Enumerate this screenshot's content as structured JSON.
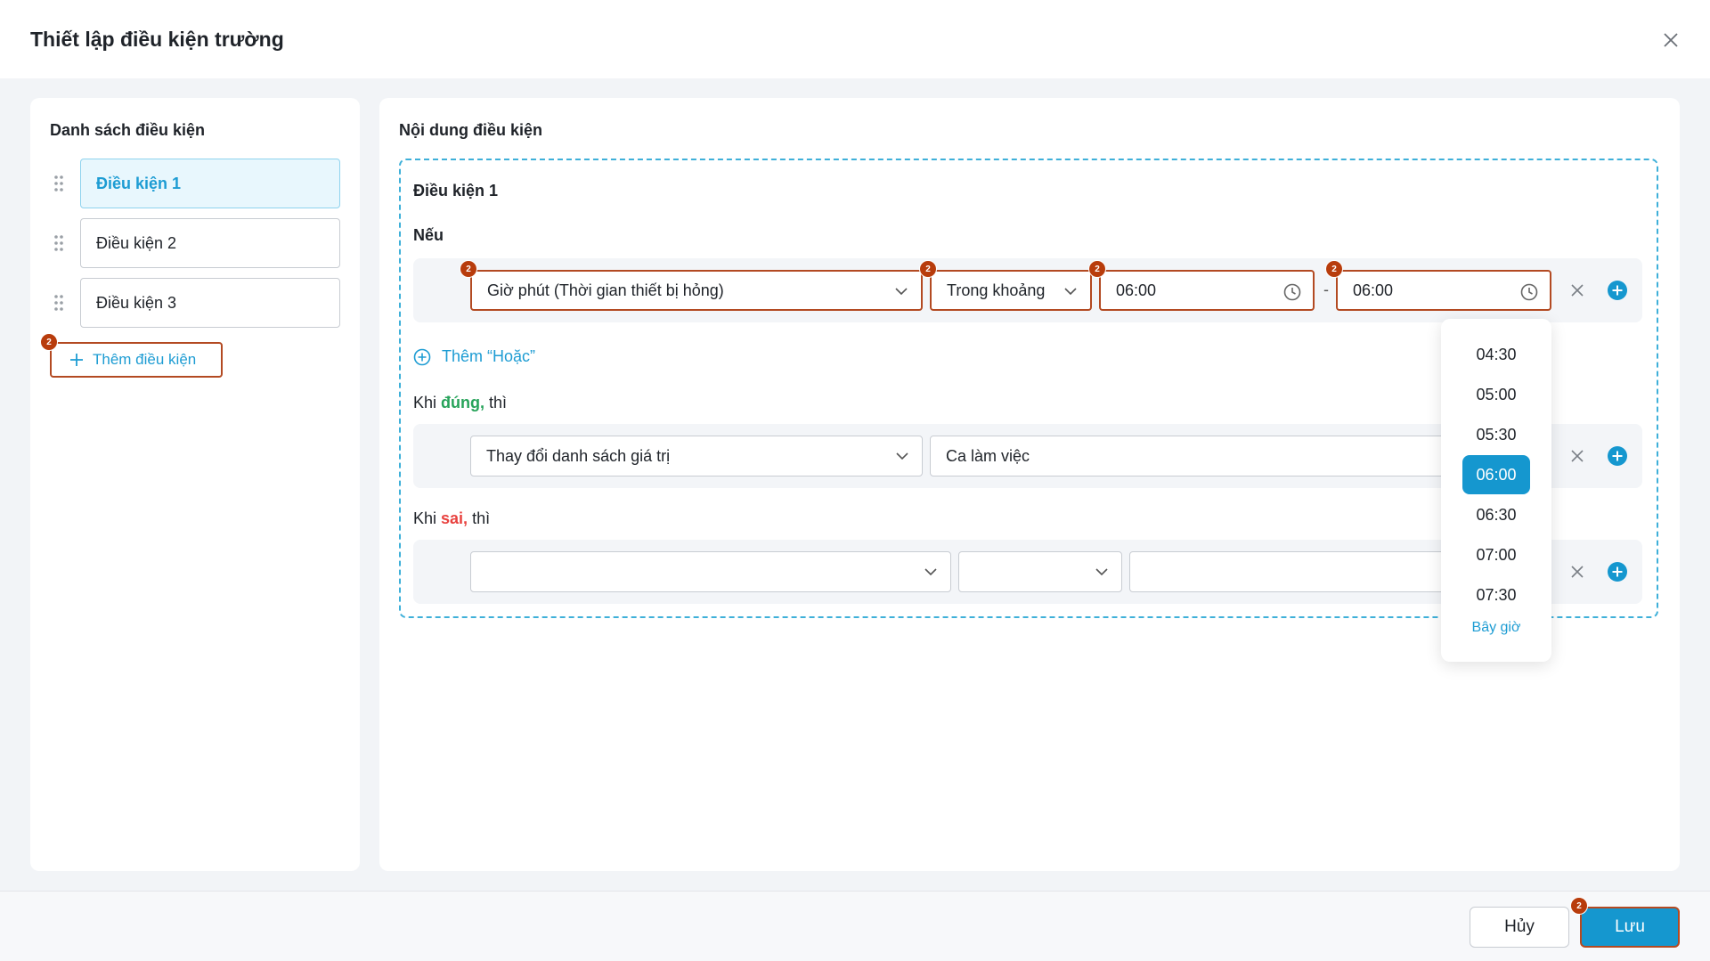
{
  "dialog": {
    "title": "Thiết lập điều kiện trường"
  },
  "left_panel": {
    "title": "Danh sách điều kiện",
    "items": [
      {
        "label": "Điều kiện 1",
        "active": true
      },
      {
        "label": "Điều kiện 2",
        "active": false
      },
      {
        "label": "Điều kiện 3",
        "active": false
      }
    ],
    "add_label": "Thêm điều kiện",
    "add_badge": "2"
  },
  "right_panel": {
    "title": "Nội dung điều kiện",
    "condition_title": "Điều kiện 1",
    "if_label": "Nếu",
    "if_row": {
      "field": "Giờ phút (Thời gian thiết bị hỏng)",
      "operator": "Trong khoảng",
      "time_from": "06:00",
      "separator": "-",
      "time_to": "06:00",
      "badge": "2"
    },
    "add_or_label": "Thêm “Hoặc”",
    "when_true": {
      "prefix": "Khi",
      "word": "đúng,",
      "suffix": "thì"
    },
    "true_row": {
      "action": "Thay đổi danh sách giá trị",
      "target": "Ca làm việc"
    },
    "when_false": {
      "prefix": "Khi",
      "word": "sai,",
      "suffix": "thì"
    },
    "false_row": {
      "action": "",
      "operator": "",
      "value": ""
    }
  },
  "time_dropdown": {
    "options": [
      "04:30",
      "05:00",
      "05:30",
      "06:00",
      "06:30",
      "07:00",
      "07:30"
    ],
    "selected": "06:00",
    "now_label": "Bây giờ"
  },
  "footer": {
    "cancel_label": "Hủy",
    "save_label": "Lưu",
    "save_badge": "2"
  },
  "colors": {
    "accent": "#1597cf",
    "error_border": "#b34a22",
    "badge": "#b83c0c",
    "true_word": "#27a35a",
    "false_word": "#e8423f"
  }
}
